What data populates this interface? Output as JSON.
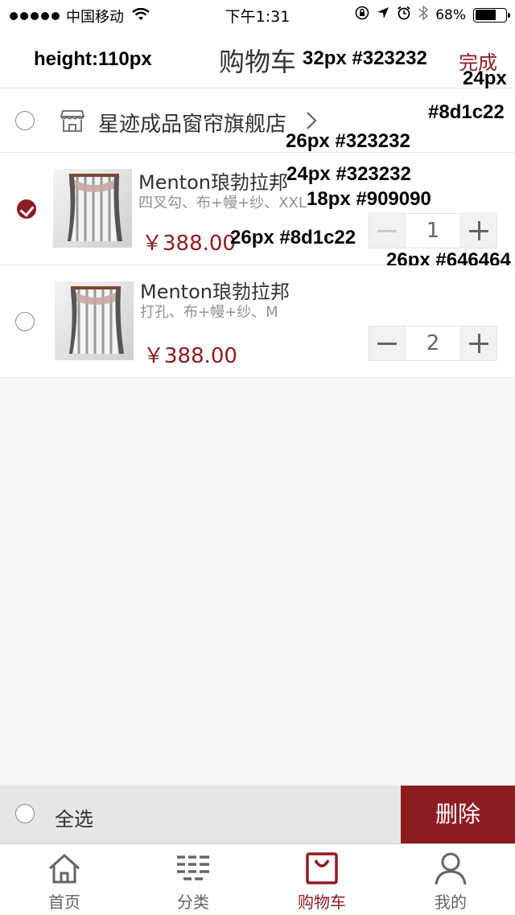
{
  "status_bar": {
    "carrier": "中国移动",
    "time": "下午1:31",
    "battery": "68%",
    "battery_level": 0.68
  },
  "header": {
    "title": "购物车",
    "done_label": "完成"
  },
  "annotations": {
    "header_height": "height:110px",
    "title_spec": "32px #323232",
    "done_size": "24px",
    "done_color": "#8d1c22",
    "shop_spec": "26px #323232",
    "name_spec": "24px #323232",
    "spec_spec": "18px #909090",
    "price_spec": "26px #8d1c22",
    "qty_spec": "26px #646464"
  },
  "shop": {
    "name": "星迹成品窗帘旗舰店",
    "selected": false
  },
  "items": [
    {
      "name": "Menton琅勃拉邦",
      "spec": "四叉勾、布+幔+纱、XXL",
      "price": "￥388.00",
      "qty": "1",
      "selected": true
    },
    {
      "name": "Menton琅勃拉邦",
      "spec": "打孔、布+幔+纱、M",
      "price": "￥388.00",
      "qty": "2",
      "selected": false
    }
  ],
  "bottom_bar": {
    "select_all_label": "全选",
    "delete_label": "删除"
  },
  "tabs": [
    {
      "label": "首页",
      "icon": "home-icon",
      "active": false
    },
    {
      "label": "分类",
      "icon": "category-icon",
      "active": false
    },
    {
      "label": "购物车",
      "icon": "cart-icon",
      "active": true
    },
    {
      "label": "我的",
      "icon": "profile-icon",
      "active": false
    }
  ],
  "colors": {
    "accent": "#8d1c22",
    "text": "#323232",
    "subtext": "#909090",
    "stepper_text": "#646464"
  }
}
